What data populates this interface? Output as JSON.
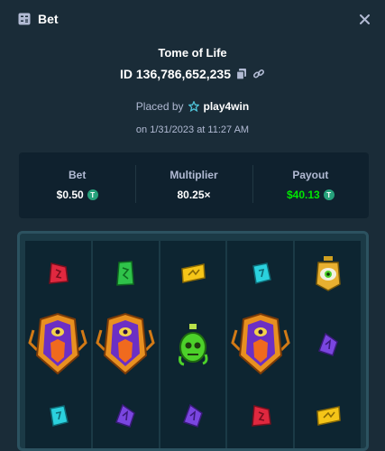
{
  "header": {
    "title": "Bet",
    "icon": "bet-icon",
    "close_icon": "close-icon"
  },
  "game": {
    "title": "Tome of Life"
  },
  "bet": {
    "id": "ID 136,786,652,235",
    "placed_by_label": "Placed by",
    "user": "play4win",
    "date": "on 1/31/2023 at 11:27 AM"
  },
  "stats": {
    "bet_label": "Bet",
    "bet_value": "$0.50",
    "multiplier_label": "Multiplier",
    "multiplier_value": "80.25×",
    "payout_label": "Payout",
    "payout_value": "$40.13"
  },
  "colors": {
    "background": "#1a2c38",
    "panel": "#0f212e",
    "payout": "#00e701",
    "muted": "#b1bad3"
  },
  "reels": [
    [
      "red-rune-gem",
      "purple-pharaoh-symbol",
      "cyan-rune-gem"
    ],
    [
      "green-rune-gem",
      "purple-pharaoh-symbol",
      "purple-rune-gem"
    ],
    [
      "yellow-rune-gem",
      "green-potion-skull",
      "purple-rune-gem"
    ],
    [
      "cyan-rune-gem",
      "purple-pharaoh-symbol",
      "red-rune-gem"
    ],
    [
      "golden-eye-amulet",
      "purple-rune-gem",
      "yellow-rune-gem"
    ]
  ]
}
